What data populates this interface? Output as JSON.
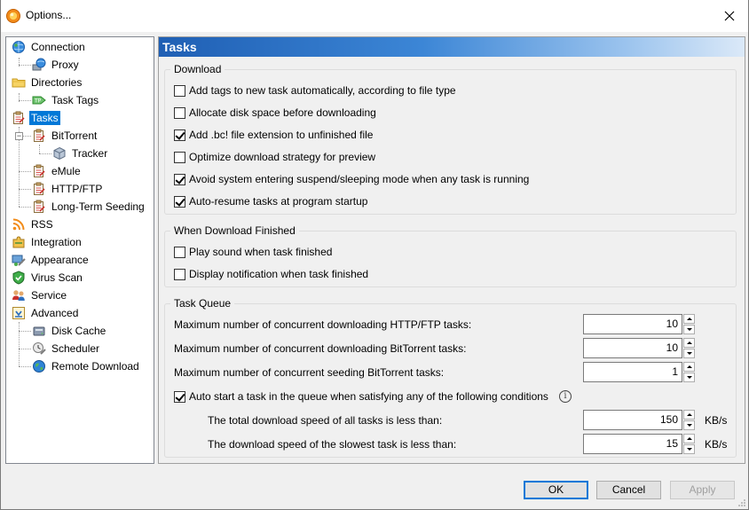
{
  "window": {
    "title": "Options...",
    "icon": "bitcomet-icon",
    "close_glyph": "✕"
  },
  "tree": [
    {
      "label": "Connection",
      "icon": "globe-network-icon"
    },
    {
      "label": "Proxy",
      "icon": "globe-computer-icon"
    },
    {
      "label": "Directories",
      "icon": "folder-icon"
    },
    {
      "label": "Task Tags",
      "icon": "tag-icon"
    },
    {
      "label": "Tasks",
      "icon": "clipboard-icon",
      "selected": true
    },
    {
      "label": "BitTorrent",
      "icon": "clipboard-icon"
    },
    {
      "label": "Tracker",
      "icon": "cube-icon"
    },
    {
      "label": "eMule",
      "icon": "clipboard-icon"
    },
    {
      "label": "HTTP/FTP",
      "icon": "clipboard-icon"
    },
    {
      "label": "Long-Term Seeding",
      "icon": "clipboard-icon"
    },
    {
      "label": "RSS",
      "icon": "rss-icon"
    },
    {
      "label": "Integration",
      "icon": "puzzle-icon"
    },
    {
      "label": "Appearance",
      "icon": "appearance-icon"
    },
    {
      "label": "Virus Scan",
      "icon": "shield-icon"
    },
    {
      "label": "Service",
      "icon": "users-icon"
    },
    {
      "label": "Advanced",
      "icon": "advanced-icon"
    },
    {
      "label": "Disk Cache",
      "icon": "disk-icon"
    },
    {
      "label": "Scheduler",
      "icon": "scheduler-icon"
    },
    {
      "label": "Remote Download",
      "icon": "globe-icon"
    }
  ],
  "panel": {
    "title": "Tasks",
    "download": {
      "title": "Download",
      "options": [
        {
          "label": "Add tags to new task automatically, according to file type",
          "checked": false
        },
        {
          "label": "Allocate disk space before downloading",
          "checked": false
        },
        {
          "label": "Add .bc! file extension to unfinished file",
          "checked": true
        },
        {
          "label": "Optimize download strategy for preview",
          "checked": false
        },
        {
          "label": "Avoid system entering suspend/sleeping mode when any task is running",
          "checked": true
        },
        {
          "label": "Auto-resume tasks at program startup",
          "checked": true
        }
      ]
    },
    "finished": {
      "title": "When Download Finished",
      "options": [
        {
          "label": "Play sound when task finished",
          "checked": false
        },
        {
          "label": "Display notification when task finished",
          "checked": false
        }
      ]
    },
    "queue": {
      "title": "Task Queue",
      "max_http_label": "Maximum number of concurrent downloading HTTP/FTP tasks:",
      "max_http_value": "10",
      "max_bt_label": "Maximum number of concurrent downloading BitTorrent tasks:",
      "max_bt_value": "10",
      "max_seed_label": "Maximum number of concurrent seeding BitTorrent tasks:",
      "max_seed_value": "1",
      "auto_start_label": "Auto start a task in the queue when satisfying any of the following conditions",
      "auto_start_checked": true,
      "info_glyph": "i",
      "total_speed_label": "The total download speed of all tasks is less than:",
      "total_speed_value": "150",
      "slowest_speed_label": "The download speed of the slowest task is less than:",
      "slowest_speed_value": "15",
      "unit": "KB/s"
    }
  },
  "buttons": {
    "ok": "OK",
    "cancel": "Cancel",
    "apply": "Apply"
  },
  "colors": {
    "selection": "#0078d7",
    "header_gradient_start": "#1f5fb4",
    "header_gradient_end": "#dbe9f8"
  }
}
